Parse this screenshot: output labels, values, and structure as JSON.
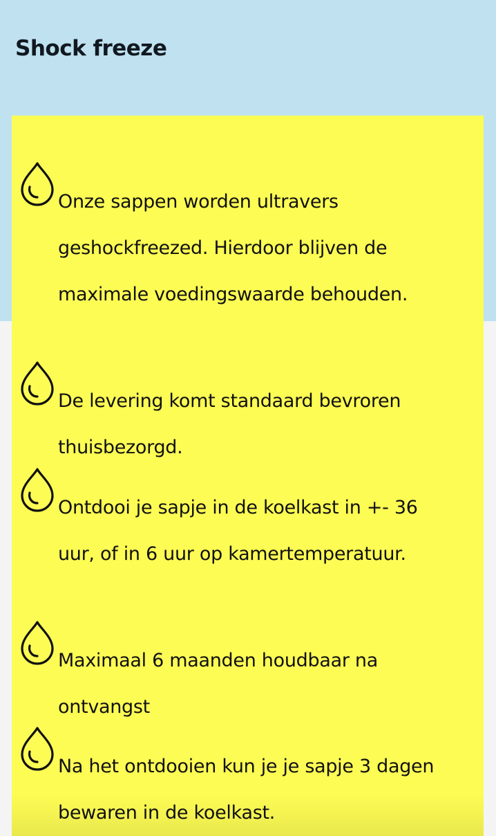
{
  "section": {
    "title": "Shock freeze"
  },
  "features": [
    {
      "icon": "water-drop-icon",
      "text": "Onze sappen worden ultravers geshockfreezed. Hierdoor blijven de maximale voedingswaarde behouden."
    },
    {
      "icon": "water-drop-icon",
      "text": "De levering komt standaard bevroren thuisbezorgd."
    },
    {
      "icon": "water-drop-icon",
      "text": "Ontdooi je sapje in de koelkast in +- 36 uur, of in 6 uur op kamertemperatuur."
    },
    {
      "icon": "water-drop-icon",
      "text": "Maximaal 6 maanden houdbaar na ontvangst"
    },
    {
      "icon": "water-drop-icon",
      "text": "Na het ontdooien kun je je sapje 3 dagen bewaren in de koelkast."
    }
  ],
  "colors": {
    "header_background": "#bfe1f0",
    "card_background": "#fdfc54",
    "page_background": "#f4f4f4",
    "text": "#111111"
  }
}
